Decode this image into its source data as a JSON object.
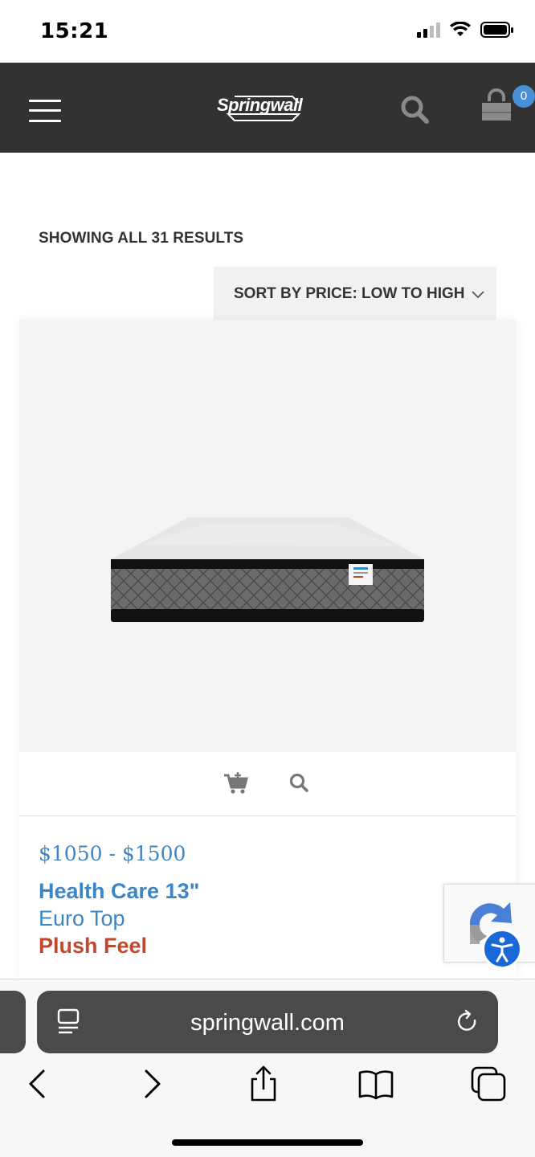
{
  "status_bar": {
    "time": "15:21"
  },
  "header": {
    "logo_text": "Springwall",
    "cart_count": "0"
  },
  "results": {
    "count_text": "SHOWING ALL 31 RESULTS",
    "sort_label": "SORT BY PRICE: LOW TO HIGH"
  },
  "product": {
    "price": "$1050 - $1500",
    "name": "Health Care 13\"",
    "type": "Euro Top",
    "feel": "Plush Feel"
  },
  "browser": {
    "url": "springwall.com"
  },
  "colors": {
    "header_bg": "#323232",
    "link_blue": "#3d86c6",
    "feel_red": "#c0482e",
    "badge_blue": "#4a90d9",
    "a11y_blue": "#1868d8"
  }
}
